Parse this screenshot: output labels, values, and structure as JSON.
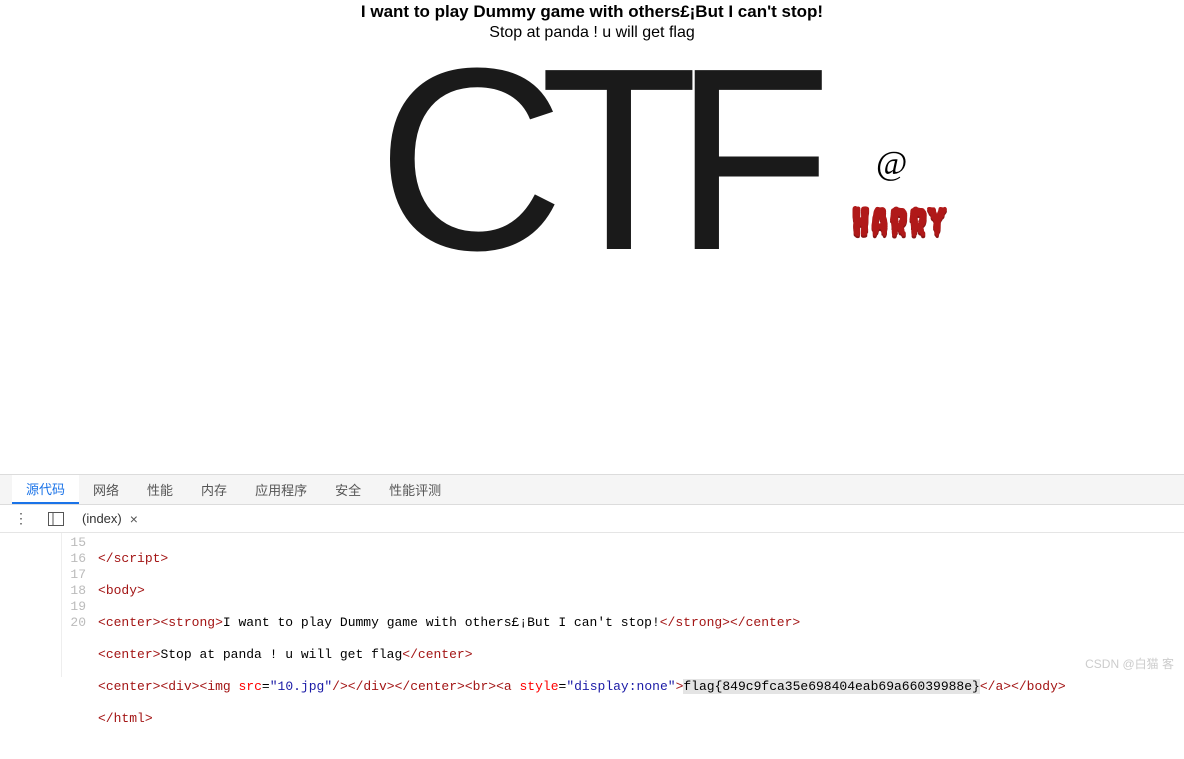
{
  "page": {
    "heading": "I want to play Dummy game with others£¡But I can't stop!",
    "subheading": "Stop at panda ! u will get flag",
    "logo_text": "CTF",
    "at": "@",
    "harry": "Harry"
  },
  "devtools": {
    "tabs": {
      "source": "源代码",
      "network": "网络",
      "performance": "性能",
      "memory": "内存",
      "application": "应用程序",
      "security": "安全",
      "perf_test": "性能评测"
    },
    "index_tab": "(index)",
    "close": "×",
    "code": {
      "line_numbers": [
        "15",
        "16",
        "17",
        "18",
        "19",
        "20"
      ],
      "l15_close": "</",
      "l15_script": "script",
      "l15_end": ">",
      "l16_open": "<",
      "l16_body": "body",
      "l16_end": ">",
      "l17_c1o": "<",
      "l17_center": "center",
      "l17_c1c": ">",
      "l17_s1o": "<",
      "l17_strong": "strong",
      "l17_s1c": ">",
      "l17_text": "I want to play Dummy game with others£¡But I can't stop!",
      "l17_sco": "</",
      "l17_scc": ">",
      "l17_cco": "</",
      "l17_ccc": ">",
      "l18_co": "<",
      "l18_center": "center",
      "l18_cc": ">",
      "l18_text": "Stop at panda ! u will get flag",
      "l18_cco": "</",
      "l18_ccc": ">",
      "l19_co": "<",
      "l19_center": "center",
      "l19_cc": ">",
      "l19_do": "<",
      "l19_div": "div",
      "l19_dc": ">",
      "l19_io": "<",
      "l19_img": "img",
      "l19_src_attr": " src",
      "l19_eq": "=",
      "l19_q": "\"",
      "l19_src_val": "10.jpg",
      "l19_ic": "/>",
      "l19_dco": "</",
      "l19_dcc": ">",
      "l19_cco": "</",
      "l19_ccc": ">",
      "l19_bro": "<",
      "l19_br": "br",
      "l19_brc": ">",
      "l19_ao": "<",
      "l19_a": "a",
      "l19_style_attr": " style",
      "l19_style_val": "display:none",
      "l19_ac": ">",
      "l19_flag": "flag{849c9fca35e698404eab69a66039988e}",
      "l19_aco": "</",
      "l19_acc": ">",
      "l19_bco": "</",
      "l19_body": "body",
      "l19_bcc": ">",
      "l20_co": "</",
      "l20_html": "html",
      "l20_cc": ">"
    }
  },
  "watermark": "CSDN @白猫 客"
}
